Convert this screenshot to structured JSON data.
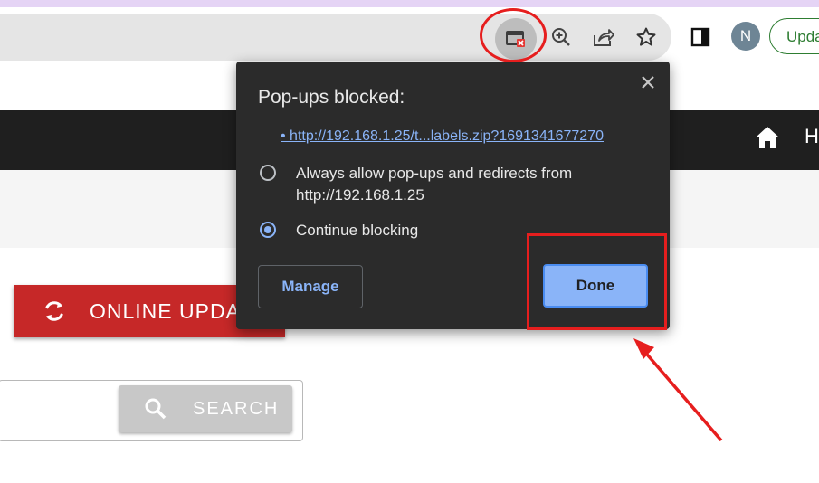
{
  "browser": {
    "avatar_initial": "N",
    "update_button_label": "Update",
    "icons": [
      "popup-blocked-icon",
      "zoom-icon",
      "share-icon",
      "bookmark-star-icon",
      "side-panel-icon"
    ]
  },
  "page": {
    "nav_text": "H",
    "online_update_label": "ONLINE UPDATE",
    "search_button_label": "SEARCH"
  },
  "dialog": {
    "title": "Pop-ups blocked:",
    "link": "•  http://192.168.1.25/t...labels.zip?1691341677270",
    "option_allow": "Always allow pop-ups and redirects from http://192.168.1.25",
    "option_continue": "Continue blocking",
    "selected_option": "Continue blocking",
    "manage_label": "Manage",
    "done_label": "Done"
  },
  "colors": {
    "annotation": "#e61e1e",
    "dialog_bg": "#2b2b2b",
    "accent_blue": "#8ab4f8",
    "online_update_red": "#c62828"
  }
}
